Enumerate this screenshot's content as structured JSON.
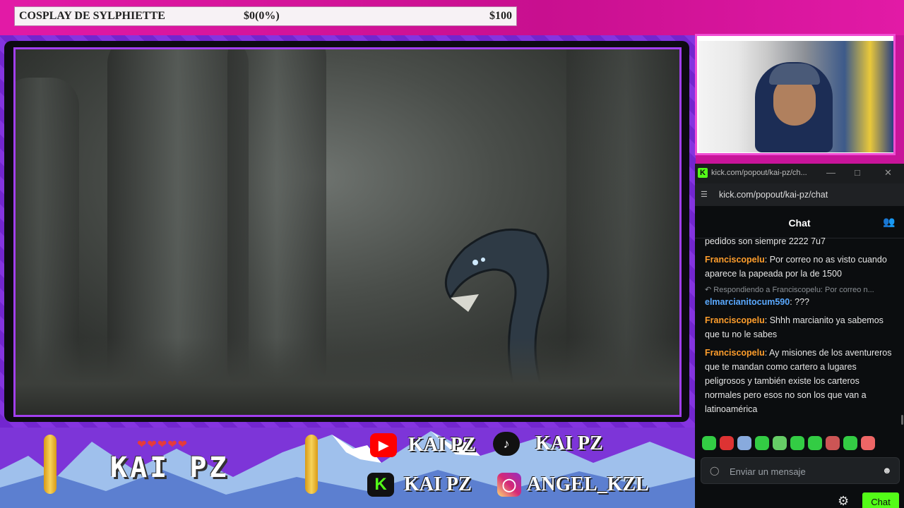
{
  "goal": {
    "title": "COSPLAY DE SYLPHIETTE",
    "current": "$0(0%)",
    "target": "$100"
  },
  "browser": {
    "tab_title": "kick.com/popout/kai-pz/ch...",
    "url": "kick.com/popout/kai-pz/chat"
  },
  "chat": {
    "header": "Chat",
    "messages": [
      {
        "user": "",
        "text": "pedidos son siempre 2222 7u7"
      },
      {
        "user": "Franciscopelu",
        "text": "Por correo no as visto cuando aparece la papeada por la de 1500"
      },
      {
        "reply": "Respondiendo a Franciscopelu: Por correo n...",
        "user": "elmarcianitocum590",
        "text": "???"
      },
      {
        "user": "Franciscopelu",
        "text": "Shhh marcianito ya sabemos que tu no le sabes"
      },
      {
        "user": "Franciscopelu",
        "text": "Ay misiones de los aventureros que te mandan como cartero a lugares peligrosos y también existe los carteros normales pero esos no son los que van a latinoamérica"
      }
    ],
    "input_placeholder": "Enviar un mensaje",
    "send_label": "Chat"
  },
  "banner": {
    "hearts": "❤❤❤❤❤",
    "channel_name": "KAI PZ",
    "socials": [
      {
        "platform": "youtube",
        "icon": "youtube-icon",
        "handle": "KAI PZ",
        "color": "#ff0000"
      },
      {
        "platform": "tiktok",
        "icon": "tiktok-icon",
        "handle": "KAI PZ",
        "color": "#111111"
      },
      {
        "platform": "kick",
        "icon": "kick-icon",
        "handle": "KAI PZ",
        "color": "#53fc18"
      },
      {
        "platform": "instagram",
        "icon": "instagram-icon",
        "handle": "ANGEL_KZL",
        "color": "#d62976"
      }
    ]
  },
  "colors": {
    "kick_green": "#53fc18",
    "frame_purple": "#a23ff0",
    "top_pink": "#e21aa6",
    "username_orange": "#ff9e2c",
    "username_blue": "#5aa9ff"
  }
}
